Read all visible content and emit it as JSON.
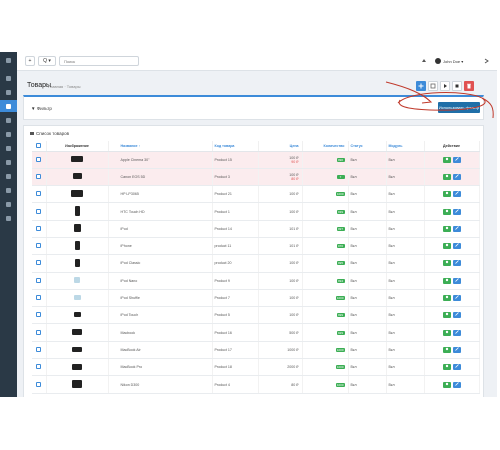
{
  "topbar": {
    "add_label": "+",
    "search_dropdown_label": "Q ▾",
    "search_placeholder": "Поиск",
    "user_name": "John Doe ▾"
  },
  "header": {
    "title": "Товары",
    "breadcrumb": "Главная · Товары"
  },
  "filter": {
    "label": "▼ Фильтр",
    "apply_label": "Использовать фильтр"
  },
  "list": {
    "title": "Список товаров",
    "columns": {
      "image": "Изображение",
      "name": "Название ↑",
      "model": "Код товара",
      "price": "Цена",
      "quantity": "Количество",
      "status": "Статус",
      "store": "Модуль",
      "action": "Действие"
    },
    "rows": [
      {
        "name": "Apple Cinema 30\"",
        "model": "Product 15",
        "price": "100 ₽",
        "price2": "90 ₽",
        "qty": "990",
        "status": "Вкл",
        "store": "Вкл"
      },
      {
        "name": "Canon EOS 5D",
        "model": "Product 3",
        "price": "100 ₽",
        "price2": "80 ₽",
        "qty": "7",
        "status": "Вкл",
        "store": "Вкл"
      },
      {
        "name": "HP LP3065",
        "model": "Product 21",
        "price": "100 ₽",
        "price2": "",
        "qty": "1000",
        "status": "Вкл",
        "store": "Вкл"
      },
      {
        "name": "HTC Touch HD",
        "model": "Product 1",
        "price": "100 ₽",
        "price2": "",
        "qty": "939",
        "status": "Вкл",
        "store": "Вкл"
      },
      {
        "name": "iPod",
        "model": "Product 14",
        "price": "101 ₽",
        "price2": "",
        "qty": "997",
        "status": "Вкл",
        "store": "Вкл"
      },
      {
        "name": "iPhone",
        "model": "product 11",
        "price": "101 ₽",
        "price2": "",
        "qty": "970",
        "status": "Вкл",
        "store": "Вкл"
      },
      {
        "name": "iPod Classic",
        "model": "product 20",
        "price": "100 ₽",
        "price2": "",
        "qty": "995",
        "status": "Вкл",
        "store": "Вкл"
      },
      {
        "name": "iPod Nano",
        "model": "Product 9",
        "price": "100 ₽",
        "price2": "",
        "qty": "994",
        "status": "Вкл",
        "store": "Вкл"
      },
      {
        "name": "iPod Shuffle",
        "model": "Product 7",
        "price": "100 ₽",
        "price2": "",
        "qty": "1000",
        "status": "Вкл",
        "store": "Вкл"
      },
      {
        "name": "iPod Touch",
        "model": "Product 5",
        "price": "100 ₽",
        "price2": "",
        "qty": "999",
        "status": "Вкл",
        "store": "Вкл"
      },
      {
        "name": "Macbook",
        "model": "Product 16",
        "price": "500 ₽",
        "price2": "",
        "qty": "929",
        "status": "Вкл",
        "store": "Вкл"
      },
      {
        "name": "MacBook Air",
        "model": "Product 17",
        "price": "1000 ₽",
        "price2": "",
        "qty": "1000",
        "status": "Вкл",
        "store": "Вкл"
      },
      {
        "name": "MacBook Pro",
        "model": "Product 18",
        "price": "2000 ₽",
        "price2": "",
        "qty": "1000",
        "status": "Вкл",
        "store": "Вкл"
      },
      {
        "name": "Nikon D300",
        "model": "Product 4",
        "price": "80 ₽",
        "price2": "",
        "qty": "1000",
        "status": "Вкл",
        "store": "Вкл"
      }
    ]
  },
  "colors": {
    "sidebar": "#2a3946",
    "accent": "#3d8bd9",
    "apply_button": "#1f6fa8",
    "success": "#3cae55",
    "danger": "#e05252",
    "annotation": "#c0392b"
  }
}
